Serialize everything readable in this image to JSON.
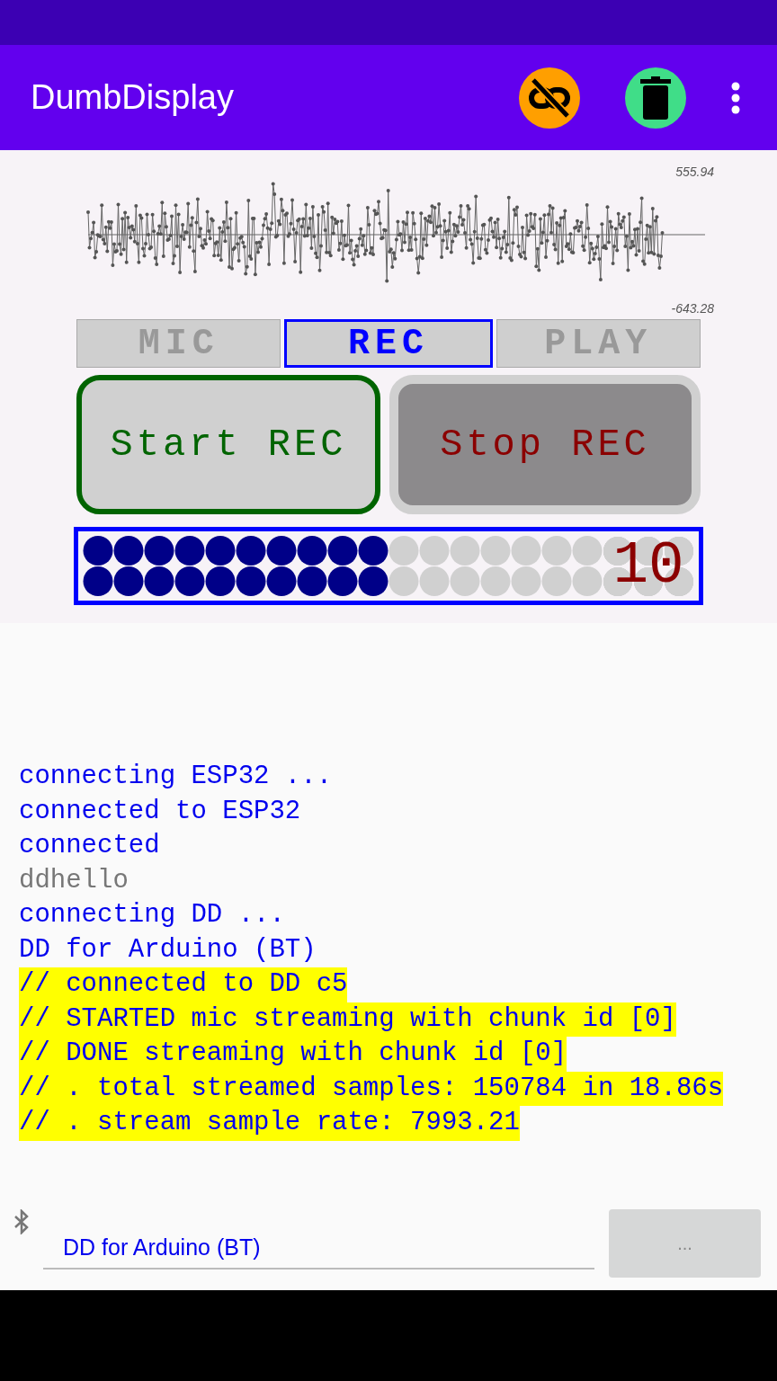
{
  "app_bar": {
    "title": "DumbDisplay"
  },
  "plot": {
    "max_label": "555.94",
    "min_label": "-643.28"
  },
  "tabs": [
    {
      "label": "MIC",
      "selected": false
    },
    {
      "label": "REC",
      "selected": true
    },
    {
      "label": "PLAY",
      "selected": false
    }
  ],
  "buttons": [
    {
      "label": "Start REC",
      "kind": "start"
    },
    {
      "label": "Stop REC",
      "kind": "stop"
    }
  ],
  "meter": {
    "reading": "10"
  },
  "log": [
    {
      "text": "connecting ESP32 ...",
      "kind": "info"
    },
    {
      "text": "connected to ESP32",
      "kind": "info"
    },
    {
      "text": "connected",
      "kind": "info"
    },
    {
      "text": "ddhello",
      "kind": "echo"
    },
    {
      "text": "connecting DD ...",
      "kind": "info"
    },
    {
      "text": "DD for Arduino (BT)",
      "kind": "info"
    },
    {
      "text": "// connected to DD c5",
      "kind": "comment"
    },
    {
      "text": "// STARTED mic streaming with chunk id [0]",
      "kind": "comment"
    },
    {
      "text": "// DONE streaming with chunk id [0]",
      "kind": "comment"
    },
    {
      "text": "// . total streamed samples: 150784 in 18.86s",
      "kind": "comment"
    },
    {
      "text": "// . stream sample rate: 7993.21",
      "kind": "comment"
    }
  ],
  "connection": {
    "device": "DD for Arduino (BT)",
    "button": "..."
  }
}
